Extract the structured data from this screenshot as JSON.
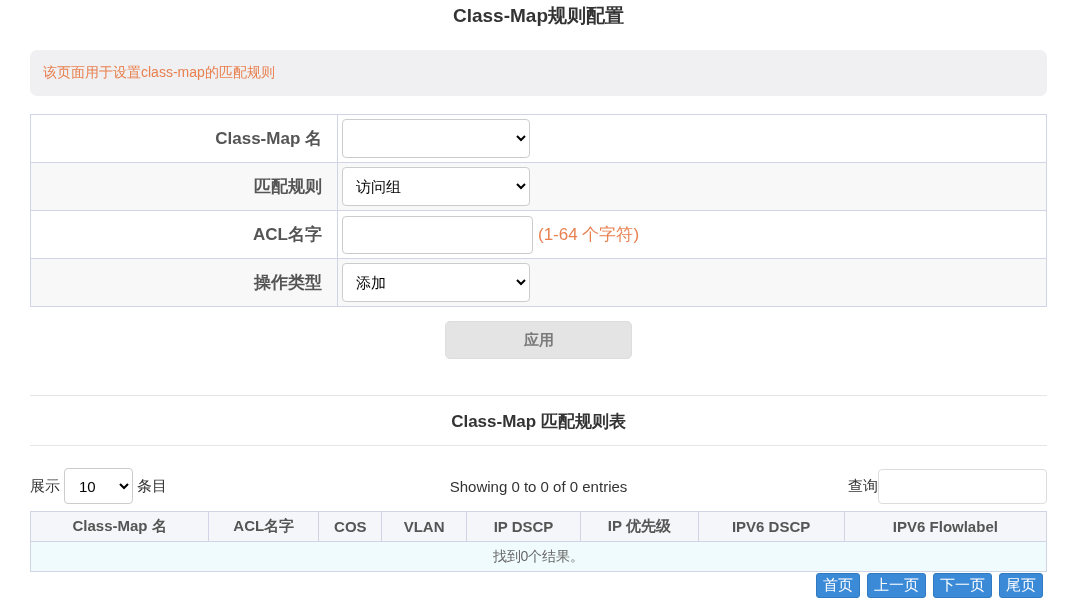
{
  "title": "Class-Map规则配置",
  "notice": "该页面用于设置class-map的匹配规则",
  "form": [
    {
      "kind": "select",
      "label": "Class-Map 名"
    },
    {
      "kind": "select",
      "label": "匹配规则",
      "value": "访问组"
    },
    {
      "kind": "input",
      "label": "ACL名字",
      "hint": "(1-64 个字符)"
    },
    {
      "kind": "select",
      "label": "操作类型",
      "value": "添加"
    }
  ],
  "apply_button": {
    "label": "应用",
    "disabled": true
  },
  "table_title": "Class-Map 匹配规则表",
  "length": {
    "prefix": "展示",
    "value": "10",
    "suffix": "条目"
  },
  "info": "Showing 0 to 0 of 0 entries",
  "search_label": "查询",
  "table": {
    "columns": [
      "Class-Map 名",
      "ACL名字",
      "COS",
      "VLAN",
      "IP DSCP",
      "IP 优先级",
      "IPV6 DSCP",
      "IPV6 Flowlabel"
    ],
    "empty": "找到0个结果。"
  },
  "pagination": [
    "首页",
    "上一页",
    "下一页",
    "尾页"
  ]
}
